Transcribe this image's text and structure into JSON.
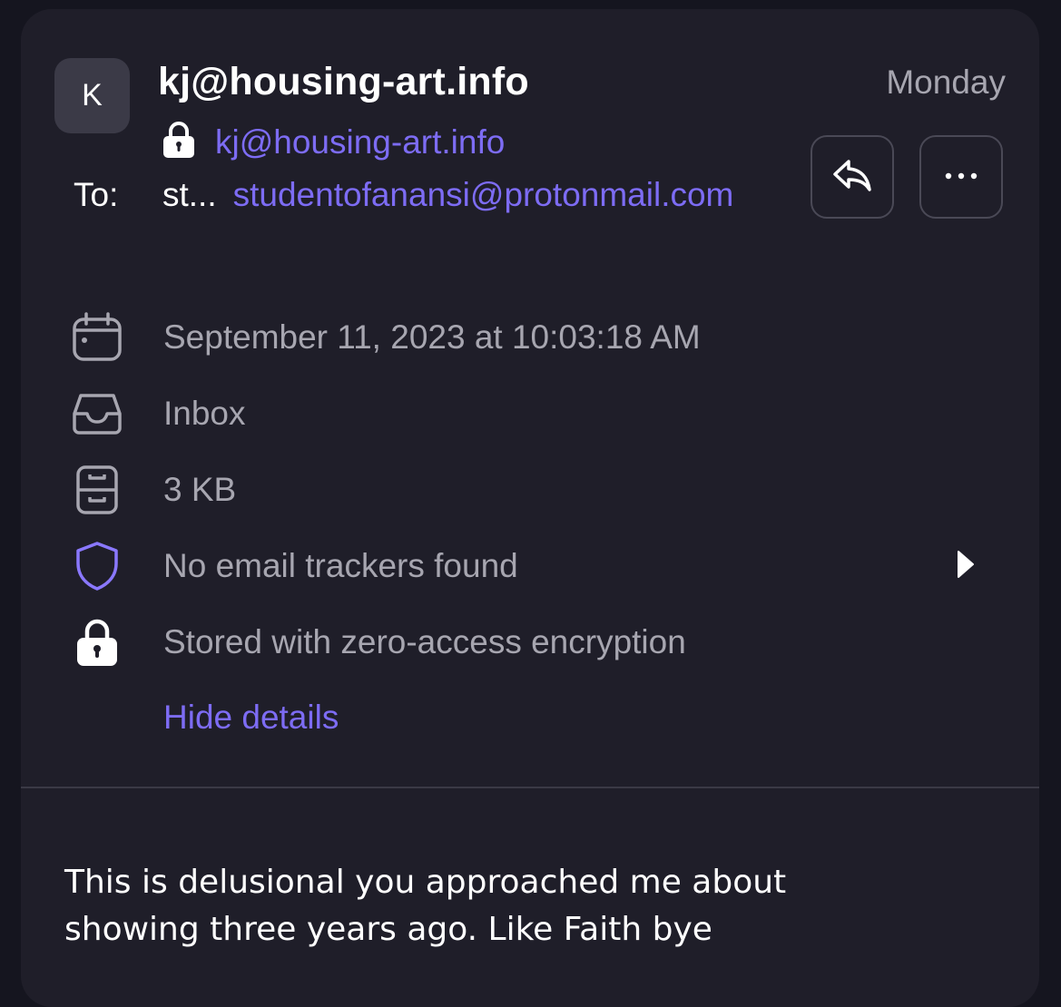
{
  "header": {
    "avatar_initial": "K",
    "sender_name": "kj@housing-art.info",
    "sender_address": "kj@housing-art.info",
    "date_short": "Monday",
    "to_label": "To:",
    "recipient_name": "st...",
    "recipient_address": "studentofanansi@protonmail.com"
  },
  "details": {
    "datetime": "September 11, 2023 at 10:03:18 AM",
    "folder": "Inbox",
    "size": "3 KB",
    "trackers": "No email trackers found",
    "encryption": "Stored with zero-access encryption",
    "hide_details": "Hide details"
  },
  "body": {
    "line1": "This is delusional you approached me about",
    "line2": "showing three years ago. Like Faith bye"
  },
  "icons": {
    "reply": "reply-icon",
    "more": "more-icon",
    "calendar": "calendar-icon",
    "inbox": "inbox-icon",
    "size": "storage-icon",
    "trackers": "shield-icon",
    "encryption": "lock-icon",
    "expand": "chevron-right-icon"
  },
  "colors": {
    "background": "#15151f",
    "card": "#1f1e29",
    "accent": "#7d6cf4",
    "muted_text": "#a7a6b0"
  }
}
